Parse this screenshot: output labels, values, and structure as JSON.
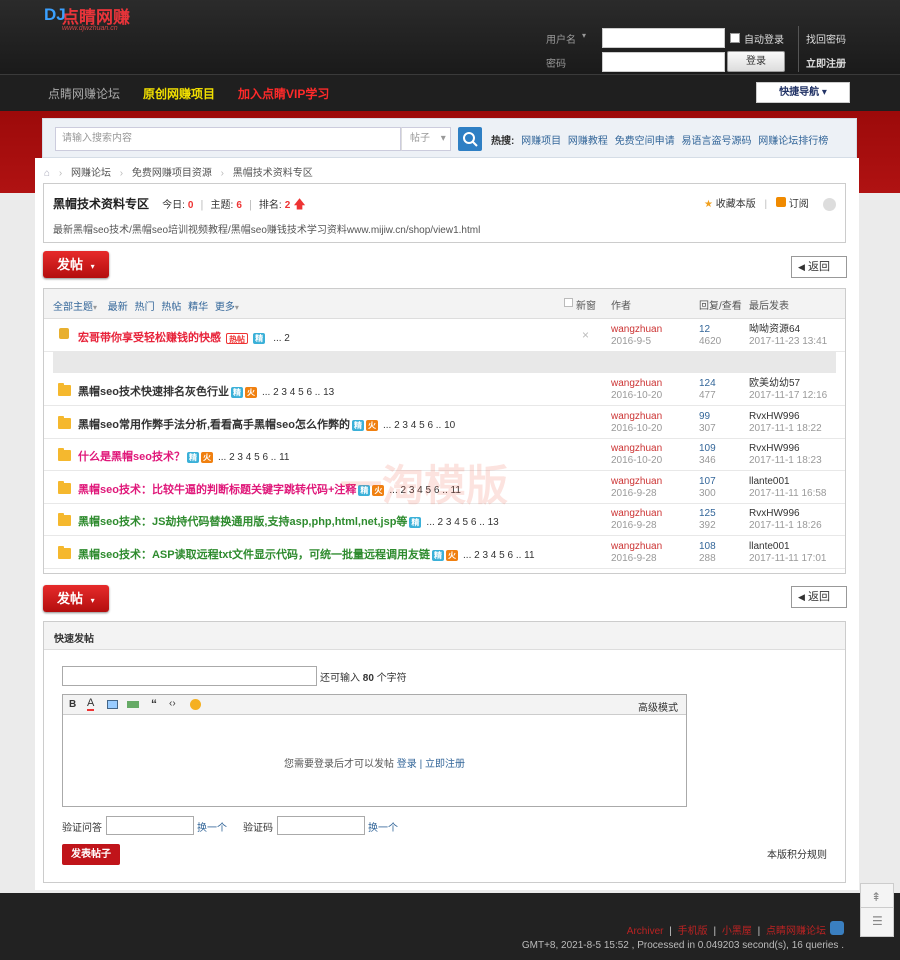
{
  "logo": {
    "mark": "DJ",
    "name": "点睛网赚",
    "sub": "www.djwzhuan.cn"
  },
  "login": {
    "username_label": "用户名",
    "password_label": "密码",
    "auto_login": "自动登录",
    "login_button": "登录",
    "find_password": "找回密码",
    "register": "立即注册"
  },
  "nav": {
    "forum": "点睛网赚论坛",
    "original": "原创网赚项目",
    "vip": "加入点睛VIP学习",
    "quick_nav": "快捷导航"
  },
  "search": {
    "placeholder": "请输入搜索内容",
    "type": "帖子",
    "hot_label": "热搜:",
    "hot": [
      "网赚项目",
      "网赚教程",
      "免费空间申请",
      "易语言盗号源码",
      "网赚论坛排行榜"
    ]
  },
  "breadcrumb": [
    "网赚论坛",
    "免费网赚项目资源",
    "黑帽技术资料专区"
  ],
  "forum": {
    "name": "黑帽技术资料专区",
    "today_label": "今日:",
    "today": "0",
    "threads_label": "主题:",
    "threads": "6",
    "rank_label": "排名:",
    "rank": "2",
    "favorite": "收藏本版",
    "subscribe": "订阅",
    "desc": "最新黑帽seo技术/黑帽seo培训视频教程/黑帽seo赚钱技术学习资料www.mijiw.cn/shop/view1.html"
  },
  "buttons": {
    "post": "发帖",
    "back": "返回"
  },
  "thread_header": {
    "all": "全部主题",
    "latest": "最新",
    "hot": "热门",
    "hotpost": "热帖",
    "digest": "精华",
    "more": "更多",
    "new_window": "新窗",
    "author": "作者",
    "reply_view": "回复/查看",
    "last_post": "最后发表"
  },
  "pinned": {
    "title": "宏哥带你享受轻松赚钱的快感",
    "tag1": "热帖",
    "tag2": "精",
    "pages": "... 2",
    "author": "wangzhuan",
    "date": "2016-9-5",
    "replies": "12",
    "views": "4620",
    "last_user": "呦呦资源64",
    "last_time": "2017-11-23 13:41"
  },
  "threads": [
    {
      "title": "黑帽seo技术快速排名灰色行业",
      "color": "#333333",
      "pages": "... 2 3 4 5 6 .. 13",
      "author": "wangzhuan",
      "date": "2016-10-20",
      "replies": "124",
      "views": "477",
      "last_user": "欧美幼幼57",
      "last_time": "2017-11-17 12:16"
    },
    {
      "title": "黑帽seo常用作弊手法分析,看看高手黑帽seo怎么作弊的",
      "color": "#333333",
      "pages": "... 2 3 4 5 6 .. 10",
      "author": "wangzhuan",
      "date": "2016-10-20",
      "replies": "99",
      "views": "307",
      "last_user": "RvxHW996",
      "last_time": "2017-11-1 18:22"
    },
    {
      "title": "什么是黑帽seo技术？",
      "color": "#e0187a",
      "pages": "... 2 3 4 5 6 .. 11",
      "author": "wangzhuan",
      "date": "2016-10-20",
      "replies": "109",
      "views": "346",
      "last_user": "RvxHW996",
      "last_time": "2017-11-1 18:23"
    },
    {
      "title": "黑帽seo技术：比较牛逼的判断标题关键字跳转代码+注释",
      "color": "#e0187a",
      "pages": "... 2 3 4 5 6 .. 11",
      "author": "wangzhuan",
      "date": "2016-9-28",
      "replies": "107",
      "views": "300",
      "last_user": "llante001",
      "last_time": "2017-11-11 16:58"
    },
    {
      "title": "黑帽seo技术：JS劫持代码替换通用版,支持asp,php,html,net,jsp等",
      "color": "#2e8b2e",
      "pages": "... 2 3 4 5 6 .. 13",
      "author": "wangzhuan",
      "date": "2016-9-28",
      "replies": "125",
      "views": "392",
      "last_user": "RvxHW996",
      "last_time": "2017-11-1 18:26"
    },
    {
      "title": "黑帽seo技术：ASP读取远程txt文件显示代码，可统一批量远程调用友链",
      "color": "#2e8b2e",
      "pages": "... 2 3 4 5 6 .. 11",
      "author": "wangzhuan",
      "date": "2016-9-28",
      "replies": "108",
      "views": "288",
      "last_user": "llante001",
      "last_time": "2017-11-11 17:01"
    }
  ],
  "tags": {
    "jing": "精",
    "huo": "火"
  },
  "quick": {
    "title": "快速发帖",
    "remain_prefix": "还可输入",
    "remain": "80",
    "remain_suffix": "个字符",
    "advanced": "高级模式",
    "need_login": "您需要登录后才可以发帖",
    "login": "登录",
    "register": "立即注册",
    "verify_q": "验证问答",
    "change": "换一个",
    "verify_code": "验证码",
    "submit": "发表帖子",
    "rules": "本版积分规则"
  },
  "footer": {
    "links": [
      "Archiver",
      "手机版",
      "小黑屋",
      "点睛网赚论坛"
    ],
    "sep": "|",
    "stats": "GMT+8, 2021-8-5 15:52 , Processed in 0.049203 second(s), 16 queries ."
  },
  "watermark": "一淘模版"
}
